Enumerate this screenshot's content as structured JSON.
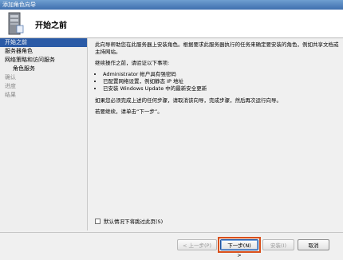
{
  "window": {
    "title": "添加角色向导"
  },
  "header": {
    "title": "开始之前"
  },
  "sidebar": {
    "items": [
      {
        "label": "开始之前"
      },
      {
        "label": "服务器角色"
      },
      {
        "label": "网络策略和访问服务"
      },
      {
        "label": "角色服务"
      },
      {
        "label": "确认"
      },
      {
        "label": "进度"
      },
      {
        "label": "结果"
      }
    ]
  },
  "content": {
    "intro": "此向导帮助您在此服务器上安装角色。根据要求此服务器执行的任务来确定要安装的角色，例如共享文档或主持网站。",
    "verify_heading": "继续操作之前，请验证以下事项:",
    "bullets": [
      "Administrator 帐户具有强密码",
      "已配置网络设置，例如静态 IP 地址",
      "已安装 Windows Update 中的最新安全更新"
    ],
    "complete_note": "如果您必须完成上述的任何步骤，请取消该向导，完成步骤，然后再次运行向导。",
    "continue_note": "若要继续，请单击“下一步”。"
  },
  "skip": {
    "label": "默认情况下将跳过此页(S)",
    "checked": false
  },
  "buttons": {
    "prev": "< 上一步(P)",
    "next": "下一步(N) >",
    "install": "安装(I)",
    "cancel": "取消"
  },
  "colors": {
    "selected_nav": "#2a5aa6",
    "highlight_border": "#d94f1a"
  }
}
